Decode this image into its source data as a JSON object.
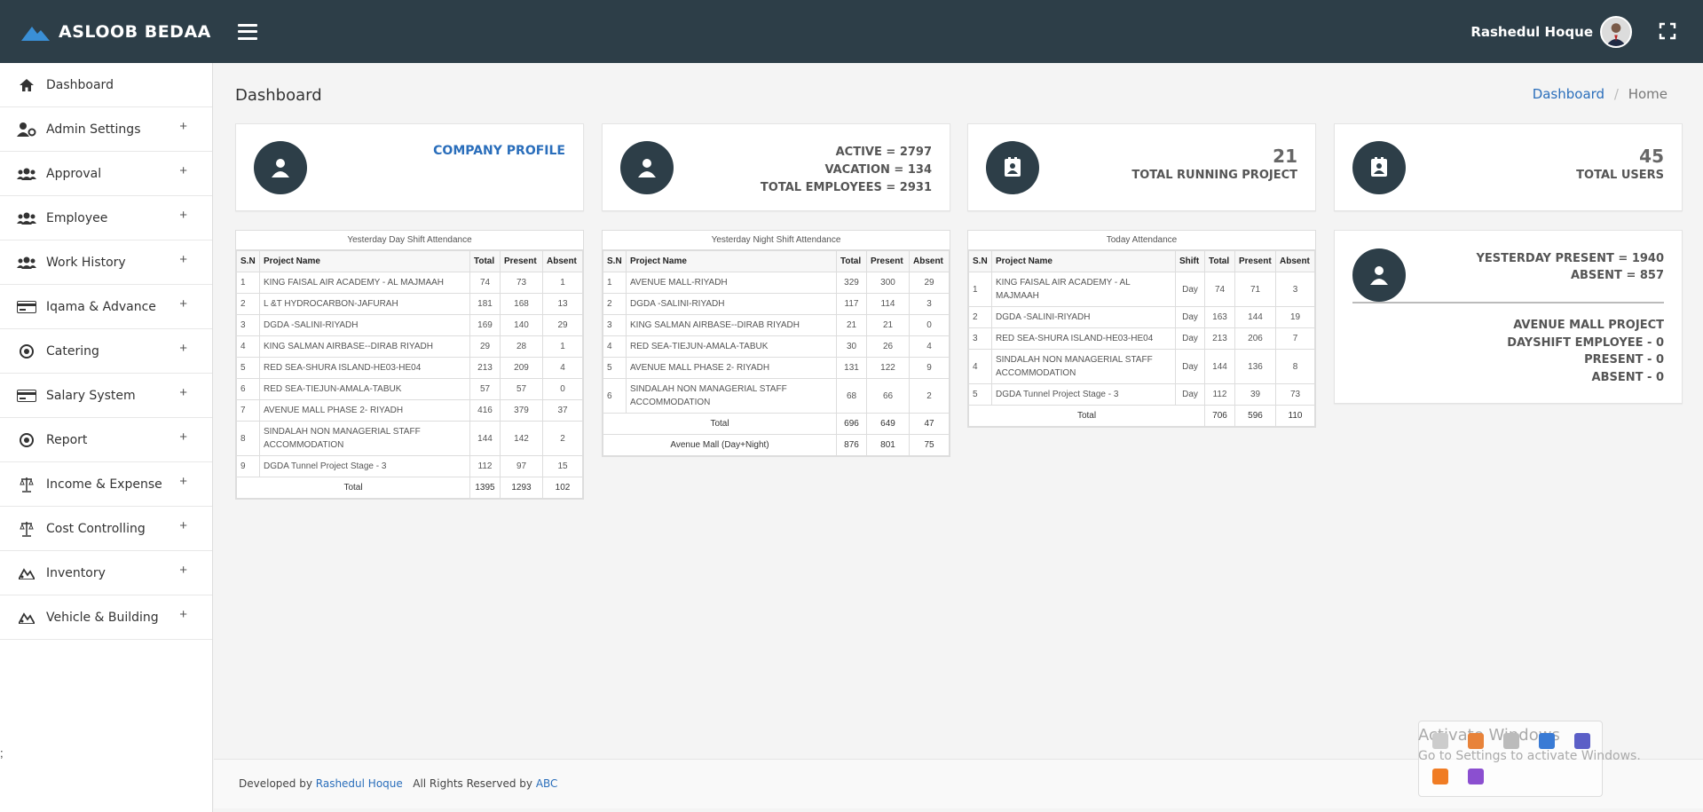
{
  "app": {
    "brand": "ASLOOB BEDAA"
  },
  "user": {
    "name": "Rashedul Hoque"
  },
  "sidebar": {
    "items": [
      {
        "label": "Dashboard",
        "icon": "home-icon",
        "expandable": false
      },
      {
        "label": "Admin Settings",
        "icon": "user-gear-icon",
        "expandable": true
      },
      {
        "label": "Approval",
        "icon": "users-icon",
        "expandable": true
      },
      {
        "label": "Employee",
        "icon": "users-icon",
        "expandable": true
      },
      {
        "label": "Work History",
        "icon": "users-icon",
        "expandable": true
      },
      {
        "label": "Iqama & Advance",
        "icon": "card-icon",
        "expandable": true
      },
      {
        "label": "Catering",
        "icon": "circle-dot-icon",
        "expandable": true
      },
      {
        "label": "Salary System",
        "icon": "card-icon",
        "expandable": true
      },
      {
        "label": "Report",
        "icon": "circle-dot-icon",
        "expandable": true
      },
      {
        "label": "Income & Expense",
        "icon": "scale-icon",
        "expandable": true
      },
      {
        "label": "Cost Controlling",
        "icon": "scale-icon",
        "expandable": true
      },
      {
        "label": "Inventory",
        "icon": "mountain-icon",
        "expandable": true
      },
      {
        "label": "Vehicle & Building",
        "icon": "mountain-icon",
        "expandable": true
      }
    ],
    "plus": "+",
    "stray": ";"
  },
  "header": {
    "title": "Dashboard",
    "breadcrumb": {
      "link": "Dashboard",
      "separator": "/",
      "current": "Home"
    }
  },
  "cards": {
    "company": {
      "label": "COMPANY PROFILE"
    },
    "employees": {
      "active": "ACTIVE = 2797",
      "vacation": "VACATION = 134",
      "total": "TOTAL EMPLOYEES = 2931"
    },
    "projects": {
      "count": "21",
      "label": "TOTAL RUNNING PROJECT"
    },
    "users": {
      "count": "45",
      "label": "TOTAL USERS"
    },
    "yesterday": {
      "present": "YESTERDAY PRESENT = 1940",
      "absent": "ABSENT = 857",
      "project": "AVENUE MALL PROJECT",
      "dayshift": "DAYSHIFT EMPLOYEE - 0",
      "present2": "PRESENT - 0",
      "absent2": "ABSENT - 0"
    }
  },
  "tables": {
    "day": {
      "caption": "Yesterday Day Shift Attendance",
      "headers": [
        "S.N",
        "Project Name",
        "Total",
        "Present",
        "Absent"
      ],
      "rows": [
        [
          "1",
          "KING FAISAL AIR ACADEMY - AL MAJMAAH",
          "74",
          "73",
          "1"
        ],
        [
          "2",
          "L &T HYDROCARBON-JAFURAH",
          "181",
          "168",
          "13"
        ],
        [
          "3",
          "DGDA -SALINI-RIYADH",
          "169",
          "140",
          "29"
        ],
        [
          "4",
          "KING SALMAN AIRBASE--DIRAB RIYADH",
          "29",
          "28",
          "1"
        ],
        [
          "5",
          "RED SEA-SHURA ISLAND-HE03-HE04",
          "213",
          "209",
          "4"
        ],
        [
          "6",
          "RED SEA-TIEJUN-AMALA-TABUK",
          "57",
          "57",
          "0"
        ],
        [
          "7",
          "AVENUE MALL PHASE 2- RIYADH",
          "416",
          "379",
          "37"
        ],
        [
          "8",
          "SINDALAH NON MANAGERIAL STAFF ACCOMMODATION",
          "144",
          "142",
          "2"
        ],
        [
          "9",
          "DGDA Tunnel Project Stage - 3",
          "112",
          "97",
          "15"
        ]
      ],
      "total": [
        "Total",
        "1395",
        "1293",
        "102"
      ]
    },
    "night": {
      "caption": "Yesterday Night Shift Attendance",
      "headers": [
        "S.N",
        "Project Name",
        "Total",
        "Present",
        "Absent"
      ],
      "rows": [
        [
          "1",
          "AVENUE MALL-RIYADH",
          "329",
          "300",
          "29"
        ],
        [
          "2",
          "DGDA -SALINI-RIYADH",
          "117",
          "114",
          "3"
        ],
        [
          "3",
          "KING SALMAN AIRBASE--DIRAB RIYADH",
          "21",
          "21",
          "0"
        ],
        [
          "4",
          "RED SEA-TIEJUN-AMALA-TABUK",
          "30",
          "26",
          "4"
        ],
        [
          "5",
          "AVENUE MALL PHASE 2- RIYADH",
          "131",
          "122",
          "9"
        ],
        [
          "6",
          "SINDALAH NON MANAGERIAL STAFF ACCOMMODATION",
          "68",
          "66",
          "2"
        ]
      ],
      "total": [
        "Total",
        "696",
        "649",
        "47"
      ],
      "extra": [
        "Avenue Mall (Day+Night)",
        "876",
        "801",
        "75"
      ]
    },
    "today": {
      "caption": "Today Attendance",
      "headers": [
        "S.N",
        "Project Name",
        "Shift",
        "Total",
        "Present",
        "Absent"
      ],
      "rows": [
        [
          "1",
          "KING FAISAL AIR ACADEMY - AL MAJMAAH",
          "Day",
          "74",
          "71",
          "3"
        ],
        [
          "2",
          "DGDA -SALINI-RIYADH",
          "Day",
          "163",
          "144",
          "19"
        ],
        [
          "3",
          "RED SEA-SHURA ISLAND-HE03-HE04",
          "Day",
          "213",
          "206",
          "7"
        ],
        [
          "4",
          "SINDALAH NON MANAGERIAL STAFF ACCOMMODATION",
          "Day",
          "144",
          "136",
          "8"
        ],
        [
          "5",
          "DGDA Tunnel Project Stage - 3",
          "Day",
          "112",
          "39",
          "73"
        ]
      ],
      "total": [
        "Total",
        "706",
        "596",
        "110"
      ]
    }
  },
  "footer": {
    "prefix": "Developed by",
    "author": "Rashedul Hoque",
    "rights": "All Rights Reserved by",
    "company": "ABC"
  },
  "overlay": {
    "title": "Activate Windows",
    "subtitle": "Go to Settings to activate Windows."
  },
  "colors": {
    "topbar": "#2d3e48",
    "accent": "#2a6ebb",
    "brand_logo": "#3a8fd6"
  }
}
